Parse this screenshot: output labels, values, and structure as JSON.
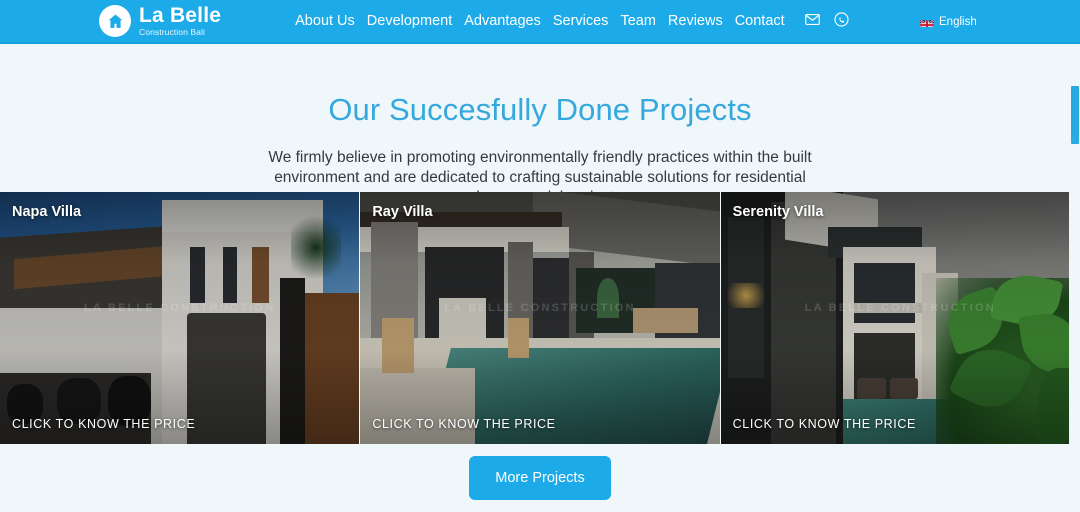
{
  "header": {
    "brand": {
      "logo_icon": "home-icon",
      "name": "La Belle",
      "tagline": "Construction Bali"
    },
    "nav": [
      {
        "label": "About Us"
      },
      {
        "label": "Development"
      },
      {
        "label": "Advantages"
      },
      {
        "label": "Services"
      },
      {
        "label": "Team"
      },
      {
        "label": "Reviews"
      },
      {
        "label": "Contact"
      }
    ],
    "contact_icons": [
      {
        "name": "email-icon"
      },
      {
        "name": "whatsapp-icon"
      }
    ],
    "language": {
      "flag": "uk-flag-icon",
      "label": "English"
    },
    "background_color": "#1cabe8"
  },
  "intro": {
    "title": "Our Succesfully Done Projects",
    "title_color": "#35a8dd",
    "description": "We firmly believe in promoting environmentally friendly practices within the built environment and are dedicated to crafting sustainable solutions for residential and commercial projects."
  },
  "projects": {
    "cta_label": "CLICK TO KNOW THE PRICE",
    "watermark": "LA BELLE CONSTRUCTION",
    "cards": [
      {
        "title": "Napa Villa",
        "cta": "CLICK TO KNOW THE PRICE"
      },
      {
        "title": "Ray Villa",
        "cta": "CLICK TO KNOW THE PRICE"
      },
      {
        "title": "Serenity Villa",
        "cta": "CLICK TO KNOW THE PRICE"
      }
    ]
  },
  "footer": {
    "more_button": "More Projects",
    "accent_color": "#1cabe8"
  },
  "scrollbar": {
    "thumb_color": "#29abe2"
  }
}
